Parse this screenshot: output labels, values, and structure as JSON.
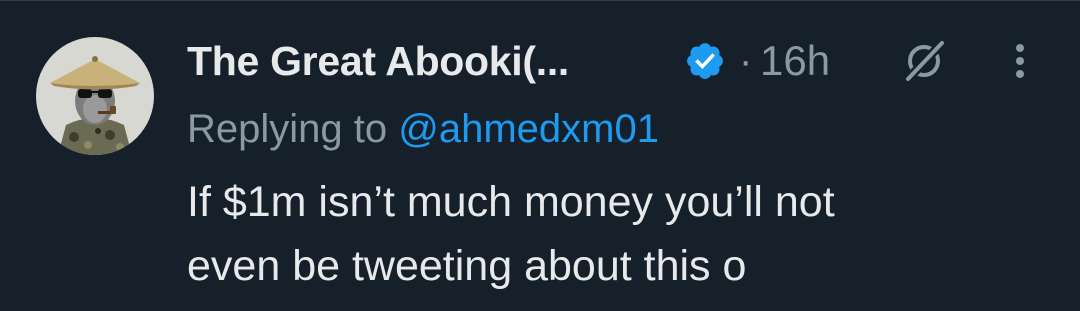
{
  "tweet": {
    "author": {
      "display_name": "The Great Abooki(...",
      "avatar_icon": "avatar-image",
      "verified_icon": "verified-badge-icon",
      "verified_color": "#1d9bf0"
    },
    "separator": "·",
    "timestamp": "16h",
    "reply": {
      "prefix": "Replying to",
      "mention": "@ahmedxm01"
    },
    "text_lines": [
      "If $1m isn’t much money you’ll not",
      "even be tweeting about this o"
    ],
    "actions": {
      "grok_icon": "grok-icon",
      "more_icon": "more-options-icon"
    }
  },
  "colors": {
    "background": "#15202b",
    "text_primary": "#e7e9ea",
    "text_secondary": "#8b98a5",
    "accent": "#1d9bf0"
  }
}
